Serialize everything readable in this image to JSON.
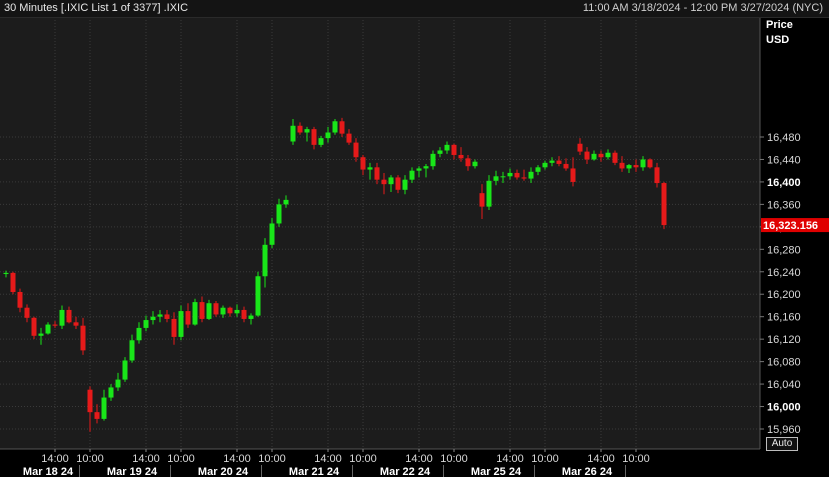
{
  "header": {
    "title": "30 Minutes [.IXIC List 1 of 3377] .IXIC",
    "range": "11:00 AM 3/18/2024 - 12:00 PM 3/27/2024 (NYC)"
  },
  "axis": {
    "price_label": "Price",
    "currency_label": "USD",
    "last_price_label": "16,323.156",
    "auto_label": "Auto"
  },
  "colors": {
    "up": "#19e619",
    "down": "#e61a1a",
    "background": "#1c1c1c",
    "grid": "#3a3a3a",
    "last_price_bg": "#e00000"
  },
  "chart_data": {
    "type": "candlestick",
    "title": "30 Minutes [.IXIC List 1 of 3377] .IXIC",
    "ylabel": "Price USD",
    "ylim": [
      15940,
      16520
    ],
    "y_ticks": [
      15960,
      16000,
      16040,
      16080,
      16120,
      16160,
      16200,
      16240,
      16280,
      16320,
      16360,
      16400,
      16440,
      16480
    ],
    "y_tick_labels": [
      "15,960",
      "16,000",
      "16,040",
      "16,080",
      "16,120",
      "16,160",
      "16,200",
      "16,240",
      "16,280",
      "16,320",
      "16,360",
      "16,400",
      "16,440",
      "16,480"
    ],
    "bold_ticks": [
      "16,000",
      "16,400"
    ],
    "last_price": 16323.156,
    "x_time_ticks": [
      {
        "label": "14:00",
        "bar": 7
      },
      {
        "label": "10:00",
        "bar": 12
      },
      {
        "label": "14:00",
        "bar": 20
      },
      {
        "label": "10:00",
        "bar": 25
      },
      {
        "label": "14:00",
        "bar": 33
      },
      {
        "label": "10:00",
        "bar": 38
      },
      {
        "label": "14:00",
        "bar": 46
      },
      {
        "label": "10:00",
        "bar": 51
      },
      {
        "label": "14:00",
        "bar": 59
      },
      {
        "label": "10:00",
        "bar": 64
      },
      {
        "label": "14:00",
        "bar": 72
      },
      {
        "label": "10:00",
        "bar": 77
      },
      {
        "label": "14:00",
        "bar": 85
      },
      {
        "label": "10:00",
        "bar": 90
      }
    ],
    "day_labels": [
      {
        "label": "Mar 18 24",
        "bar": 6
      },
      {
        "label": "Mar 19 24",
        "bar": 18
      },
      {
        "label": "Mar 20 24",
        "bar": 31
      },
      {
        "label": "Mar 21 24",
        "bar": 44
      },
      {
        "label": "Mar 22 24",
        "bar": 57
      },
      {
        "label": "Mar 25 24",
        "bar": 70
      },
      {
        "label": "Mar 26 24",
        "bar": 83
      }
    ],
    "day_separators": [
      11,
      24,
      37,
      50,
      63,
      76,
      89
    ],
    "ohlc": [
      [
        16236,
        16242,
        16230,
        16238
      ],
      [
        16238,
        16240,
        16200,
        16204
      ],
      [
        16204,
        16210,
        16168,
        16176
      ],
      [
        16176,
        16182,
        16150,
        16158
      ],
      [
        16158,
        16160,
        16120,
        16126
      ],
      [
        16126,
        16140,
        16110,
        16130
      ],
      [
        16130,
        16150,
        16128,
        16146
      ],
      [
        16146,
        16152,
        16140,
        16144
      ],
      [
        16144,
        16180,
        16138,
        16172
      ],
      [
        16172,
        16178,
        16148,
        16150
      ],
      [
        16150,
        16160,
        16138,
        16144
      ],
      [
        16144,
        16158,
        16092,
        16100
      ],
      [
        16030,
        16036,
        15955,
        15990
      ],
      [
        15990,
        16004,
        15970,
        15978
      ],
      [
        15978,
        16030,
        15975,
        16016
      ],
      [
        16016,
        16040,
        16010,
        16034
      ],
      [
        16034,
        16060,
        16028,
        16048
      ],
      [
        16048,
        16088,
        16044,
        16082
      ],
      [
        16082,
        16128,
        16078,
        16118
      ],
      [
        16118,
        16150,
        16112,
        16140
      ],
      [
        16140,
        16162,
        16134,
        16154
      ],
      [
        16154,
        16170,
        16146,
        16160
      ],
      [
        16160,
        16172,
        16150,
        16164
      ],
      [
        16164,
        16172,
        16150,
        16156
      ],
      [
        16156,
        16168,
        16110,
        16124
      ],
      [
        16124,
        16180,
        16118,
        16170
      ],
      [
        16170,
        16184,
        16140,
        16146
      ],
      [
        16146,
        16192,
        16144,
        16186
      ],
      [
        16186,
        16196,
        16150,
        16156
      ],
      [
        16156,
        16190,
        16154,
        16184
      ],
      [
        16184,
        16188,
        16160,
        16164
      ],
      [
        16164,
        16180,
        16158,
        16176
      ],
      [
        16176,
        16178,
        16160,
        16166
      ],
      [
        16166,
        16182,
        16160,
        16172
      ],
      [
        16172,
        16178,
        16150,
        16156
      ],
      [
        16156,
        16166,
        16146,
        16162
      ],
      [
        16162,
        16240,
        16160,
        16232
      ],
      [
        16232,
        16300,
        16212,
        16288
      ],
      [
        16288,
        16336,
        16282,
        16326
      ],
      [
        16326,
        16370,
        16320,
        16360
      ],
      [
        16360,
        16376,
        16354,
        16368
      ],
      [
        16472,
        16512,
        16466,
        16500
      ],
      [
        16500,
        16506,
        16484,
        16488
      ],
      [
        16488,
        16498,
        16472,
        16494
      ],
      [
        16494,
        16498,
        16458,
        16466
      ],
      [
        16466,
        16482,
        16462,
        16478
      ],
      [
        16478,
        16498,
        16470,
        16488
      ],
      [
        16488,
        16512,
        16484,
        16508
      ],
      [
        16508,
        16514,
        16480,
        16486
      ],
      [
        16486,
        16494,
        16466,
        16470
      ],
      [
        16470,
        16478,
        16436,
        16444
      ],
      [
        16444,
        16448,
        16412,
        16422
      ],
      [
        16422,
        16434,
        16404,
        16426
      ],
      [
        16426,
        16434,
        16396,
        16404
      ],
      [
        16404,
        16416,
        16378,
        16396
      ],
      [
        16396,
        16412,
        16382,
        16408
      ],
      [
        16408,
        16412,
        16380,
        16386
      ],
      [
        16386,
        16412,
        16378,
        16404
      ],
      [
        16404,
        16426,
        16398,
        16420
      ],
      [
        16420,
        16428,
        16408,
        16424
      ],
      [
        16424,
        16432,
        16408,
        16428
      ],
      [
        16428,
        16456,
        16422,
        16450
      ],
      [
        16450,
        16462,
        16444,
        16456
      ],
      [
        16456,
        16472,
        16450,
        16466
      ],
      [
        16466,
        16468,
        16440,
        16448
      ],
      [
        16448,
        16462,
        16436,
        16442
      ],
      [
        16442,
        16448,
        16420,
        16428
      ],
      [
        16428,
        16440,
        16424,
        16436
      ],
      [
        16380,
        16396,
        16334,
        16356
      ],
      [
        16356,
        16412,
        16350,
        16402
      ],
      [
        16402,
        16420,
        16394,
        16410
      ],
      [
        16410,
        16418,
        16398,
        16410
      ],
      [
        16410,
        16424,
        16404,
        16416
      ],
      [
        16416,
        16422,
        16404,
        16408
      ],
      [
        16408,
        16422,
        16402,
        16406
      ],
      [
        16406,
        16426,
        16398,
        16418
      ],
      [
        16418,
        16430,
        16412,
        16426
      ],
      [
        16426,
        16438,
        16422,
        16434
      ],
      [
        16434,
        16444,
        16428,
        16438
      ],
      [
        16438,
        16446,
        16428,
        16432
      ],
      [
        16432,
        16442,
        16420,
        16424
      ],
      [
        16424,
        16444,
        16392,
        16400
      ],
      [
        16468,
        16478,
        16448,
        16454
      ],
      [
        16454,
        16462,
        16432,
        16440
      ],
      [
        16440,
        16456,
        16438,
        16450
      ],
      [
        16450,
        16456,
        16436,
        16444
      ],
      [
        16444,
        16458,
        16440,
        16452
      ],
      [
        16452,
        16456,
        16430,
        16434
      ],
      [
        16434,
        16446,
        16418,
        16424
      ],
      [
        16424,
        16432,
        16416,
        16430
      ],
      [
        16430,
        16440,
        16418,
        16426
      ],
      [
        16426,
        16446,
        16420,
        16440
      ],
      [
        16440,
        16442,
        16424,
        16426
      ],
      [
        16426,
        16434,
        16390,
        16398
      ],
      [
        16398,
        16400,
        16316,
        16323.156
      ]
    ]
  }
}
